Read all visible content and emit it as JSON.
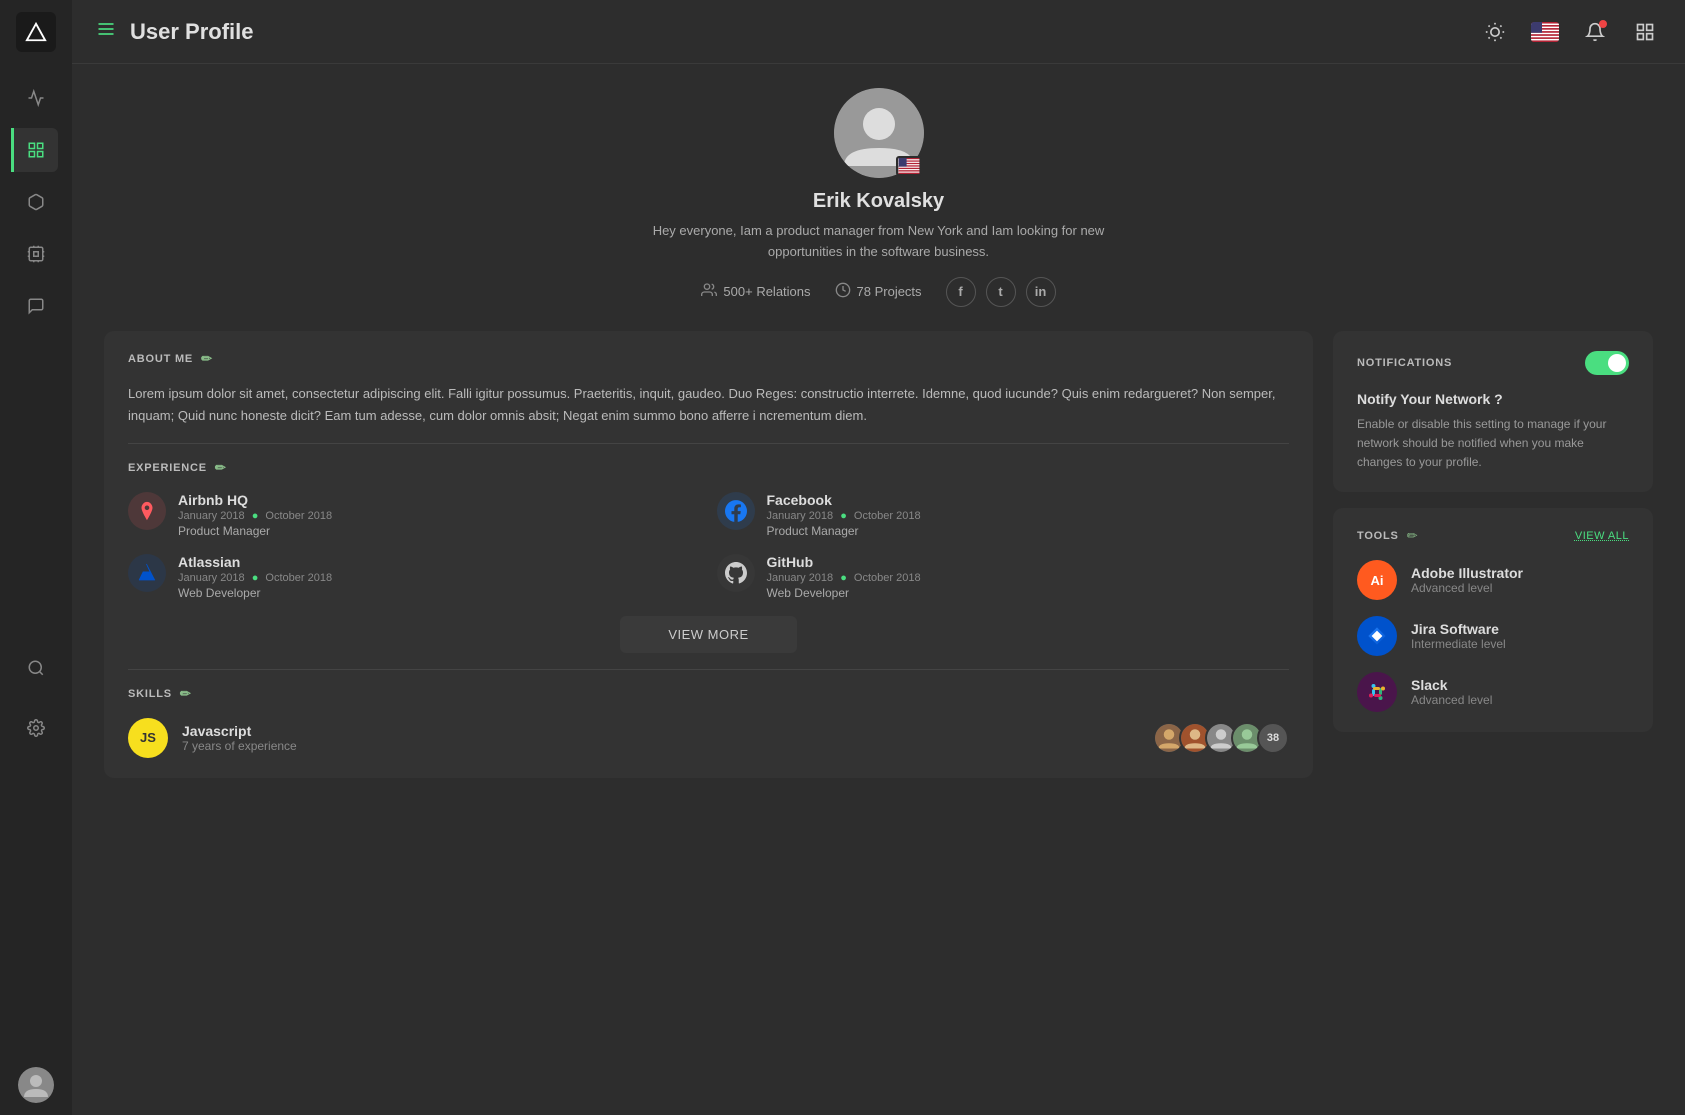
{
  "header": {
    "title": "User Profile",
    "menu_icon": "☰"
  },
  "sidebar": {
    "items": [
      {
        "name": "activity",
        "icon": "activity",
        "active": false
      },
      {
        "name": "dashboard",
        "icon": "grid",
        "active": true
      },
      {
        "name": "box",
        "icon": "box",
        "active": false
      },
      {
        "name": "chip",
        "icon": "chip",
        "active": false
      },
      {
        "name": "chat",
        "icon": "chat",
        "active": false
      },
      {
        "name": "search",
        "icon": "search",
        "active": false
      },
      {
        "name": "settings",
        "icon": "settings",
        "active": false
      }
    ]
  },
  "profile": {
    "name": "Erik Kovalsky",
    "bio": "Hey everyone,  Iam a product manager from New York and Iam looking for new opportunities in the software business.",
    "relations": "500+ Relations",
    "projects": "78 Projects",
    "social": {
      "facebook": "f",
      "twitter": "t",
      "linkedin": "in"
    }
  },
  "about": {
    "label": "ABOUT ME",
    "text": "Lorem ipsum dolor sit amet, consectetur adipiscing elit. Falli igitur possumus. Praeteritis, inquit, gaudeo. Duo Reges: constructio interrete. Idemne, quod iucunde? Quis enim redargueret? Non semper, inquam; Quid nunc honeste dicit? Eam tum adesse, cum dolor omnis absit; Negat enim summo bono afferre i ncrementum diem."
  },
  "experience": {
    "label": "EXPERIENCE",
    "items": [
      {
        "company": "Airbnb HQ",
        "date_start": "January 2018",
        "date_end": "October 2018",
        "role": "Product Manager",
        "logo_type": "airbnb"
      },
      {
        "company": "Facebook",
        "date_start": "January 2018",
        "date_end": "October 2018",
        "role": "Product Manager",
        "logo_type": "facebook"
      },
      {
        "company": "Atlassian",
        "date_start": "January 2018",
        "date_end": "October 2018",
        "role": "Web Developer",
        "logo_type": "atlassian"
      },
      {
        "company": "GitHub",
        "date_start": "January 2018",
        "date_end": "October 2018",
        "role": "Web Developer",
        "logo_type": "github"
      }
    ],
    "view_more": "VIEW MORE"
  },
  "skills": {
    "label": "SKILLS",
    "items": [
      {
        "name": "Javascript",
        "experience": "7 years of experience",
        "badge": "JS",
        "endorsements": 38
      }
    ]
  },
  "notifications": {
    "label": "NOTIFICATIONS",
    "subtitle": "Notify Your Network ?",
    "description": "Enable or disable this setting to manage if your network should be notified when you make changes to your profile.",
    "enabled": true
  },
  "tools": {
    "label": "TOOLS",
    "view_all": "VIEW ALL",
    "items": [
      {
        "name": "Adobe Illustrator",
        "level": "Advanced level",
        "logo_type": "ai"
      },
      {
        "name": "Jira Software",
        "level": "Intermediate level",
        "logo_type": "jira"
      },
      {
        "name": "Slack",
        "level": "Advanced level",
        "logo_type": "slack"
      }
    ]
  }
}
